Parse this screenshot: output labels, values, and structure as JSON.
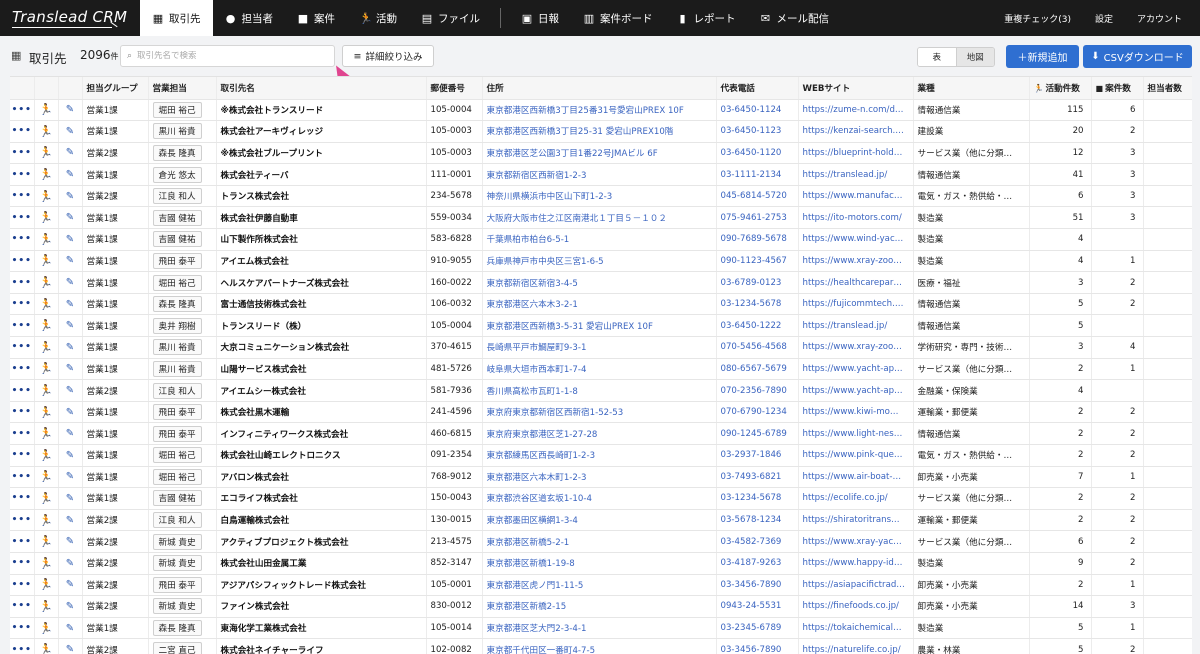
{
  "app": {
    "logo": "Translead CRM",
    "nav_tabs": [
      {
        "label": "取引先",
        "icon": "building-icon",
        "active": true
      },
      {
        "label": "担当者",
        "icon": "person-icon"
      },
      {
        "label": "案件",
        "icon": "briefcase-icon"
      },
      {
        "label": "活動",
        "icon": "runner-icon"
      },
      {
        "label": "ファイル",
        "icon": "file-icon"
      },
      {
        "label": "日報",
        "icon": "daily-report-icon"
      },
      {
        "label": "案件ボード",
        "icon": "board-icon"
      },
      {
        "label": "レポート",
        "icon": "bar-chart-icon"
      },
      {
        "label": "メール配信",
        "icon": "mail-icon"
      }
    ],
    "nav_right": [
      "重複チェック(3)",
      "設定",
      "アカウント"
    ]
  },
  "toolbar": {
    "title": "取引先",
    "count": "2096",
    "count_unit": "件",
    "search_placeholder": "取引先名で検索",
    "filter_label": "詳細絞り込み",
    "view_table": "表",
    "view_map": "地図",
    "new_label": "＋新規追加",
    "csv_label": "CSVダウンロード",
    "accent_color": "#2f6fd1"
  },
  "table": {
    "headers": [
      "担当グループ",
      "営業担当",
      "取引先名",
      "郵便番号",
      "住所",
      "代表電話",
      "WEBサイト",
      "業種",
      "活動件数",
      "案件数",
      "担当者数"
    ],
    "rows": [
      [
        "営業1課",
        "堀田 裕己",
        "※株式会社トランスリード",
        "105-0004",
        "東京都港区西新橋3丁目25番31号愛宕山PREX 10F",
        "03-6450-1124",
        "https://zume-n.com/d…",
        "情報通信業",
        "115",
        "6",
        ""
      ],
      [
        "営業1課",
        "黒川 裕貴",
        "株式会社アーキヴィレッジ",
        "105-0003",
        "東京都港区西新橋3丁目25-31 愛宕山PREX10階",
        "03-6450-1123",
        "https://kenzai-search.…",
        "建設業",
        "20",
        "2",
        ""
      ],
      [
        "営業2課",
        "森長 隆真",
        "※株式会社ブループリント",
        "105-0003",
        "東京都港区芝公園3丁目1番22号JMAビル 6F",
        "03-6450-1120",
        "https://blueprint-hold…",
        "サービス業（他に分類…",
        "12",
        "3",
        ""
      ],
      [
        "営業1課",
        "倉光 悠太",
        "株式会社ティーバ",
        "111-0001",
        "東京都新宿区西新宿1-2-3",
        "03-1111-2134",
        "https://translead.jp/",
        "情報通信業",
        "41",
        "3",
        ""
      ],
      [
        "営業2課",
        "江良 和人",
        "トランス株式会社",
        "234-5678",
        "神奈川県横浜市中区山下町1-2-3",
        "045-6814-5720",
        "https://www.manufac…",
        "電気・ガス・熱供給・…",
        "6",
        "3",
        ""
      ],
      [
        "営業1課",
        "吉國 健祐",
        "株式会社伊藤自動車",
        "559-0034",
        "大阪府大阪市住之江区南港北１丁目５－１０２",
        "075-9461-2753",
        "https://ito-motors.com/",
        "製造業",
        "51",
        "3",
        ""
      ],
      [
        "営業1課",
        "吉國 健祐",
        "山下製作所株式会社",
        "583-6828",
        "千葉県柏市柏台6-5-1",
        "090-7689-5678",
        "https://www.wind-yac…",
        "製造業",
        "4",
        "",
        ""
      ],
      [
        "営業1課",
        "飛田 泰平",
        "アイエム株式会社",
        "910-9055",
        "兵庫県神戸市中央区三宮1-6-5",
        "090-1123-4567",
        "https://www.xray-zoo…",
        "製造業",
        "4",
        "1",
        ""
      ],
      [
        "営業1課",
        "堀田 裕己",
        "ヘルスケアパートナーズ株式会社",
        "160-0022",
        "東京都新宿区新宿3-4-5",
        "03-6789-0123",
        "https://healthcarepar…",
        "医療・福祉",
        "3",
        "2",
        ""
      ],
      [
        "営業1課",
        "森長 隆真",
        "富士通信技術株式会社",
        "106-0032",
        "東京都港区六本木3-2-1",
        "03-1234-5678",
        "https://fujicommtech.…",
        "情報通信業",
        "5",
        "2",
        ""
      ],
      [
        "営業1課",
        "奥井 翔樹",
        "トランスリード（株）",
        "105-0004",
        "東京都港区西新橋3-5-31 愛宕山PREX 10F",
        "03-6450-1222",
        "https://translead.jp/",
        "情報通信業",
        "5",
        "",
        ""
      ],
      [
        "営業1課",
        "黒川 裕貴",
        "大京コミュニケーション株式会社",
        "370-4615",
        "長崎県平戸市鯛屋町9-3-1",
        "070-5456-4568",
        "https://www.xray-zoo…",
        "学術研究・専門・技術…",
        "3",
        "4",
        ""
      ],
      [
        "営業1課",
        "黒川 裕貴",
        "山陽サービス株式会社",
        "481-5726",
        "岐阜県大垣市西本町1-7-4",
        "080-6567-5679",
        "https://www.yacht-ap…",
        "サービス業（他に分類…",
        "2",
        "1",
        ""
      ],
      [
        "営業2課",
        "江良 和人",
        "アイエムシー株式会社",
        "581-7936",
        "香川県高松市瓦町1-1-8",
        "070-2356-7890",
        "https://www.yacht-ap…",
        "金融業・保険業",
        "4",
        "",
        ""
      ],
      [
        "営業1課",
        "飛田 泰平",
        "株式会社黒木運輸",
        "241-4596",
        "東京府東京都新宿区西新宿1-52-53",
        "070-6790-1234",
        "https://www.kiwi-mo…",
        "運輸業・郵便業",
        "2",
        "2",
        ""
      ],
      [
        "営業1課",
        "飛田 泰平",
        "インフィニティワークス株式会社",
        "460-6815",
        "東京府東京都港区芝1-27-28",
        "090-1245-6789",
        "https://www.light-nes…",
        "情報通信業",
        "2",
        "2",
        ""
      ],
      [
        "営業1課",
        "堀田 裕己",
        "株式会社山崎エレクトロニクス",
        "091-2354",
        "東京都練馬区西長崎町1-2-3",
        "03-2937-1846",
        "https://www.pink-que…",
        "電気・ガス・熱供給・…",
        "2",
        "2",
        ""
      ],
      [
        "営業1課",
        "堀田 裕己",
        "アバロン株式会社",
        "768-9012",
        "東京都港区六本木町1-2-3",
        "03-7493-6821",
        "https://www.air-boat-…",
        "卸売業・小売業",
        "7",
        "1",
        ""
      ],
      [
        "営業1課",
        "吉國 健祐",
        "エコライフ株式会社",
        "150-0043",
        "東京都渋谷区道玄坂1-10-4",
        "03-1234-5678",
        "https://ecolife.co.jp/",
        "サービス業（他に分類…",
        "2",
        "2",
        ""
      ],
      [
        "営業2課",
        "江良 和人",
        "白鳥運輸株式会社",
        "130-0015",
        "東京都墨田区横網1-3-4",
        "03-5678-1234",
        "https://shiratoritrans…",
        "運輸業・郵便業",
        "2",
        "2",
        ""
      ],
      [
        "営業2課",
        "新城 貴史",
        "アクティブプロジェクト株式会社",
        "213-4575",
        "東京都港区新橋5-2-1",
        "03-4582-7369",
        "https://www.xray-yac…",
        "サービス業（他に分類…",
        "6",
        "2",
        ""
      ],
      [
        "営業2課",
        "新城 貴史",
        "株式会社山田金属工業",
        "852-3147",
        "東京都港区新橋1-19-8",
        "03-4187-9263",
        "https://www.happy-id…",
        "製造業",
        "9",
        "2",
        ""
      ],
      [
        "営業2課",
        "飛田 泰平",
        "アジアパシフィックトレード株式会社",
        "105-0001",
        "東京都港区虎ノ門1-11-5",
        "03-3456-7890",
        "https://asiapacifictrad…",
        "卸売業・小売業",
        "2",
        "1",
        ""
      ],
      [
        "営業2課",
        "新城 貴史",
        "ファイン株式会社",
        "830-0012",
        "東京都港区新橋2-15",
        "0943-24-5531",
        "https://finefoods.co.jp/",
        "卸売業・小売業",
        "14",
        "3",
        ""
      ],
      [
        "営業1課",
        "森長 隆真",
        "東海化学工業株式会社",
        "105-0014",
        "東京都港区芝大門2-3-4-1",
        "03-2345-6789",
        "https://tokaichemical…",
        "製造業",
        "5",
        "1",
        ""
      ],
      [
        "営業2課",
        "二宮 直己",
        "株式会社ネイチャーライフ",
        "102-0082",
        "東京都千代田区一番町4-7-5",
        "03-3456-7890",
        "https://naturelife.co.jp/",
        "農業・林業",
        "5",
        "2",
        ""
      ]
    ]
  }
}
